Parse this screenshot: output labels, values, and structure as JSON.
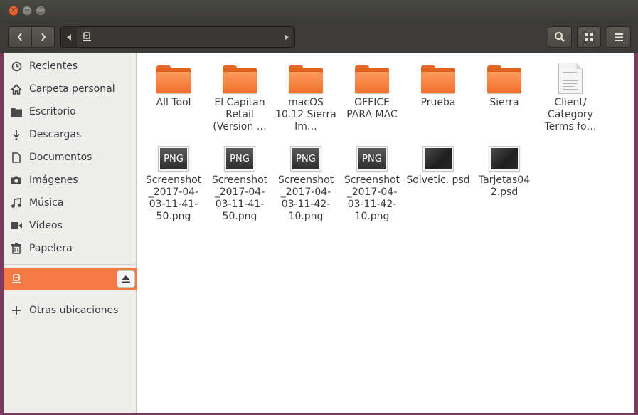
{
  "window": {
    "buttons": {
      "close": "×",
      "minimize": "−",
      "maximize": "□"
    }
  },
  "toolbar": {
    "back_icon": "chevron-left-icon",
    "forward_icon": "chevron-right-icon",
    "path": {
      "icon": "drive-icon"
    },
    "search_icon": "search-icon",
    "view_icon": "grid-view-icon",
    "menu_icon": "hamburger-menu-icon"
  },
  "sidebar": {
    "items": [
      {
        "label": "Recientes",
        "icon": "clock-icon"
      },
      {
        "label": "Carpeta personal",
        "icon": "home-icon"
      },
      {
        "label": "Escritorio",
        "icon": "folder-icon"
      },
      {
        "label": "Descargas",
        "icon": "download-icon"
      },
      {
        "label": "Documentos",
        "icon": "document-icon"
      },
      {
        "label": "Imágenes",
        "icon": "camera-icon"
      },
      {
        "label": "Música",
        "icon": "music-icon"
      },
      {
        "label": "Vídeos",
        "icon": "video-icon"
      },
      {
        "label": "Papelera",
        "icon": "trash-icon"
      }
    ],
    "device": {
      "icon": "drive-icon",
      "eject_icon": "eject-icon",
      "selected": true
    },
    "other": {
      "label": "Otras ubicaciones",
      "icon": "plus-icon"
    }
  },
  "files": [
    {
      "name": "All Tool",
      "type": "folder"
    },
    {
      "name": "El Capitan Retail (Version …",
      "type": "folder"
    },
    {
      "name": "macOS 10.12 Sierra Im…",
      "type": "folder"
    },
    {
      "name": "OFFICE PARA MAC",
      "type": "folder"
    },
    {
      "name": "Prueba",
      "type": "folder"
    },
    {
      "name": "Sierra",
      "type": "folder"
    },
    {
      "name": "Client/ Category Terms fo…",
      "type": "document"
    },
    {
      "name": "Screenshot _2017-04-03-11-41-50.png",
      "type": "png",
      "thumb_label": "PNG"
    },
    {
      "name": "Screenshot _2017-04-03-11-41-50.png",
      "type": "png",
      "thumb_label": "PNG"
    },
    {
      "name": "Screenshot _2017-04-03-11-42-10.png",
      "type": "png",
      "thumb_label": "PNG"
    },
    {
      "name": "Screenshot _2017-04-03-11-42-10.png",
      "type": "png",
      "thumb_label": "PNG"
    },
    {
      "name": "Solvetic. psd",
      "type": "psd"
    },
    {
      "name": "Tarjetas04 2.psd",
      "type": "psd"
    }
  ],
  "colors": {
    "accent": "#f37a45",
    "folder": "#f26f2a",
    "titlebar": "#3c3b37"
  }
}
